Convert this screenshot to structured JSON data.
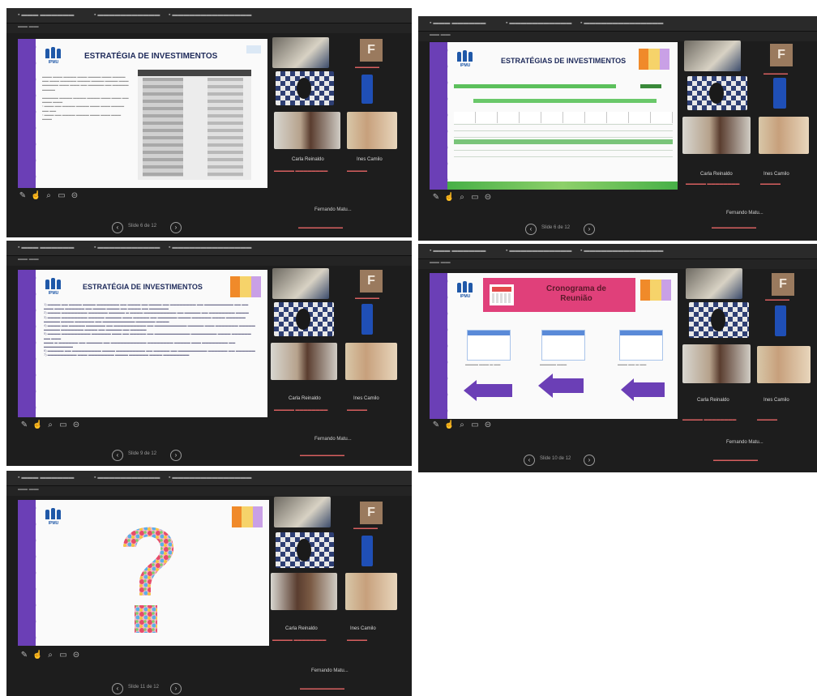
{
  "panels": [
    {
      "slide_title": "ESTRATÉGIA DE INVESTIMENTOS",
      "participant_1": "Carla Reinaldo",
      "participant_2": "Ines Camilo",
      "presenter": "Fernando Matu...",
      "pager": "Slide 6 de 12"
    },
    {
      "slide_title": "ESTRATÉGIAS DE INVESTIMENTOS",
      "participant_1": "Carla Reinaldo",
      "participant_2": "Ines Camilo",
      "presenter": "Fernando Matu...",
      "pager": "Slide 6 de 12"
    },
    {
      "slide_title": "ESTRATÉGIA DE INVESTIMENTOS",
      "participant_1": "Carla Reinaldo",
      "participant_2": "Ines Camilo",
      "presenter": "Fernando Matu...",
      "pager": "Slide 9 de 12"
    },
    {
      "slide_title": "Cronograma de Reunião",
      "participant_1": "Carla Reinaldo",
      "participant_2": "Ines Camilo",
      "presenter": "Fernando Matu...",
      "pager": "Slide 10 de 12"
    },
    {
      "slide_title": "",
      "participant_1": "Carla Reinaldo",
      "participant_2": "Ines Camilo",
      "presenter": "Fernando Matu...",
      "pager": "Slide 11 de 12"
    }
  ],
  "logo_text": "IPMU",
  "avatar_letter": "F",
  "colors": {
    "purple": "#6b3fb6",
    "navy": "#1e2a5a",
    "green": "#3aa23a",
    "pink": "#e0407a"
  }
}
